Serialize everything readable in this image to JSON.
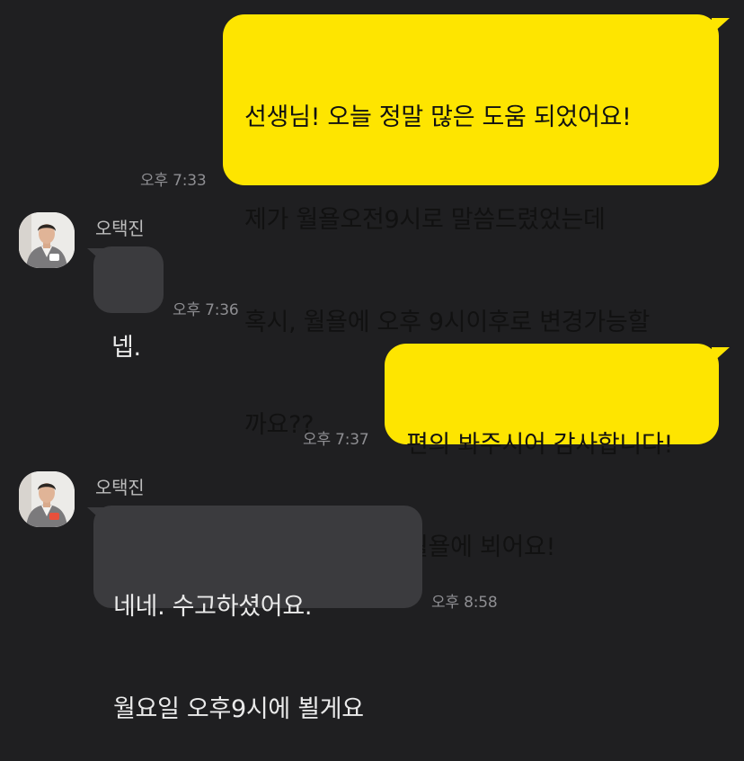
{
  "chat": {
    "messages": [
      {
        "type": "outgoing",
        "lines": [
          "선생님! 오늘 정말 많은 도움 되었어요!",
          "제가 월욜오전9시로 말씀드렸었는데",
          "혹시, 월욜에 오후 9시이후로 변경가능할",
          "까요??"
        ],
        "time": "오후 7:33"
      },
      {
        "type": "incoming",
        "sender": "오택진",
        "lines": [
          "넵."
        ],
        "time": "오후 7:36"
      },
      {
        "type": "outgoing",
        "lines": [
          "편의 봐주시어 감사합니다!",
          "월욜에 뵈어요!"
        ],
        "time": "오후 7:37"
      },
      {
        "type": "incoming",
        "sender": "오택진",
        "lines": [
          "네네. 수고하셨어요.",
          "월요일 오후9시에 뵐게요"
        ],
        "time": "오후 8:58"
      }
    ]
  },
  "theme": {
    "background": "#1f1f21",
    "outgoing_bubble": "#fee500",
    "incoming_bubble": "#3b3b3e",
    "time_color": "#8e8e92"
  },
  "icons": {
    "avatar": "profile-photo-avatar"
  }
}
